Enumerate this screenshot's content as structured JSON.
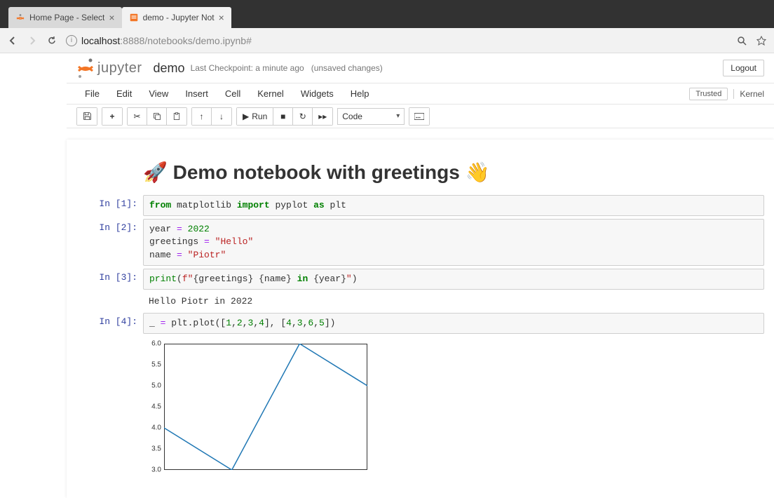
{
  "browser": {
    "tabs": [
      {
        "title": "Home Page - Select",
        "active": false
      },
      {
        "title": "demo - Jupyter Not",
        "active": true
      }
    ],
    "url_host": "localhost",
    "url_port": ":8888",
    "url_path": "/notebooks/demo.ipynb#"
  },
  "header": {
    "logo": "jupyter",
    "notebook_name": "demo",
    "checkpoint_prefix": "Last Checkpoint:",
    "checkpoint_time": "a minute ago",
    "autosave": "(unsaved changes)",
    "logout": "Logout"
  },
  "menus": [
    "File",
    "Edit",
    "View",
    "Insert",
    "Cell",
    "Kernel",
    "Widgets",
    "Help"
  ],
  "trusted": "Trusted",
  "kernel": "Kernel",
  "toolbar": {
    "run_label": "Run",
    "cell_type": "Code"
  },
  "cells": {
    "title_md": "🚀 Demo notebook with greetings 👋",
    "in1_prompt": "In [1]:",
    "in2_prompt": "In [2]:",
    "in3_prompt": "In [3]:",
    "in4_prompt": "In [4]:",
    "out3_text": "Hello Piotr in 2022"
  },
  "chart_data": {
    "type": "line",
    "x": [
      1,
      2,
      3,
      4
    ],
    "values": [
      4,
      3,
      6,
      5
    ],
    "yticks": [
      "3.0",
      "3.5",
      "4.0",
      "4.5",
      "5.0",
      "5.5",
      "6.0"
    ],
    "xlim": [
      1,
      4
    ],
    "ylim": [
      3.0,
      6.0
    ],
    "title": "",
    "xlabel": "",
    "ylabel": ""
  }
}
